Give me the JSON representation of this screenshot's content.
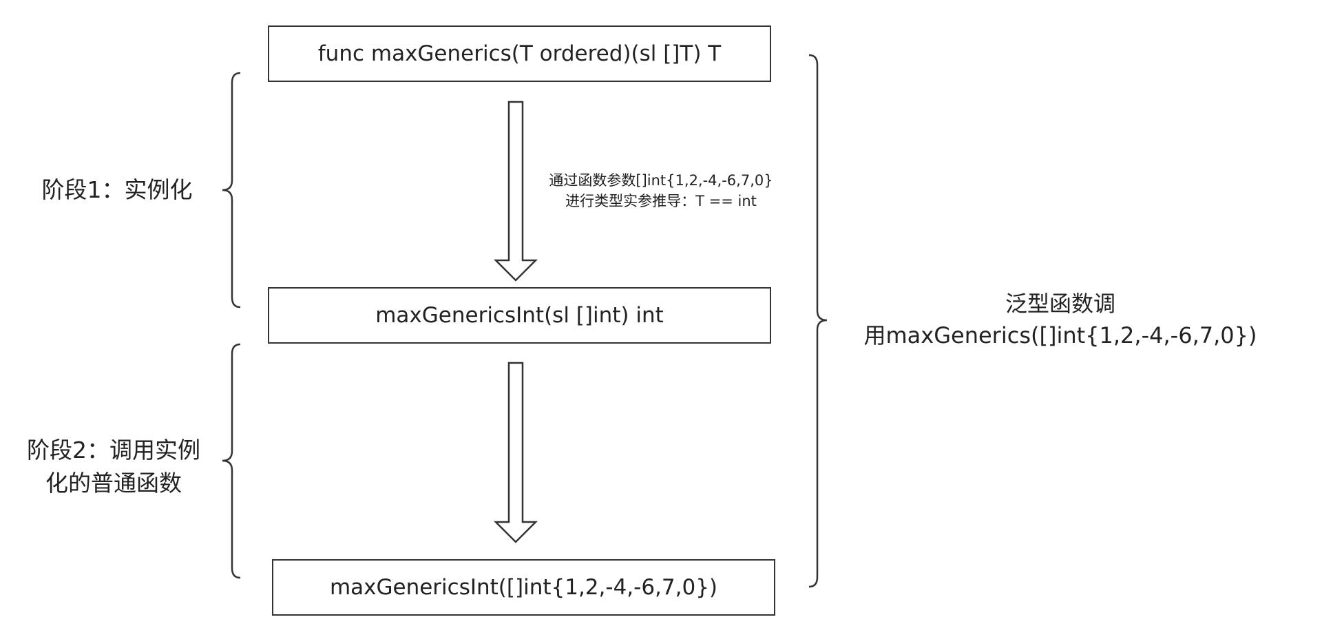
{
  "diagram": {
    "boxes": {
      "signature": "func maxGenerics(T ordered)(sl []T) T",
      "instance": "maxGenericsInt(sl []int) int",
      "call": "maxGenericsInt([]int{1,2,-4,-6,7,0})"
    },
    "stage1": {
      "line1": "阶段1：实例化"
    },
    "stage2": {
      "line1": "阶段2：调用实例",
      "line2": "化的普通函数"
    },
    "inference_note": {
      "line1": "通过函数参数[]int{1,2,-4,-6,7,0}",
      "line2": "进行类型实参推导：T == int"
    },
    "right_label": {
      "line1": "泛型函数调",
      "line2": "用maxGenerics([]int{1,2,-4,-6,7,0})"
    },
    "colors": {
      "stroke": "#333333",
      "text": "#222222",
      "background": "#ffffff"
    }
  }
}
